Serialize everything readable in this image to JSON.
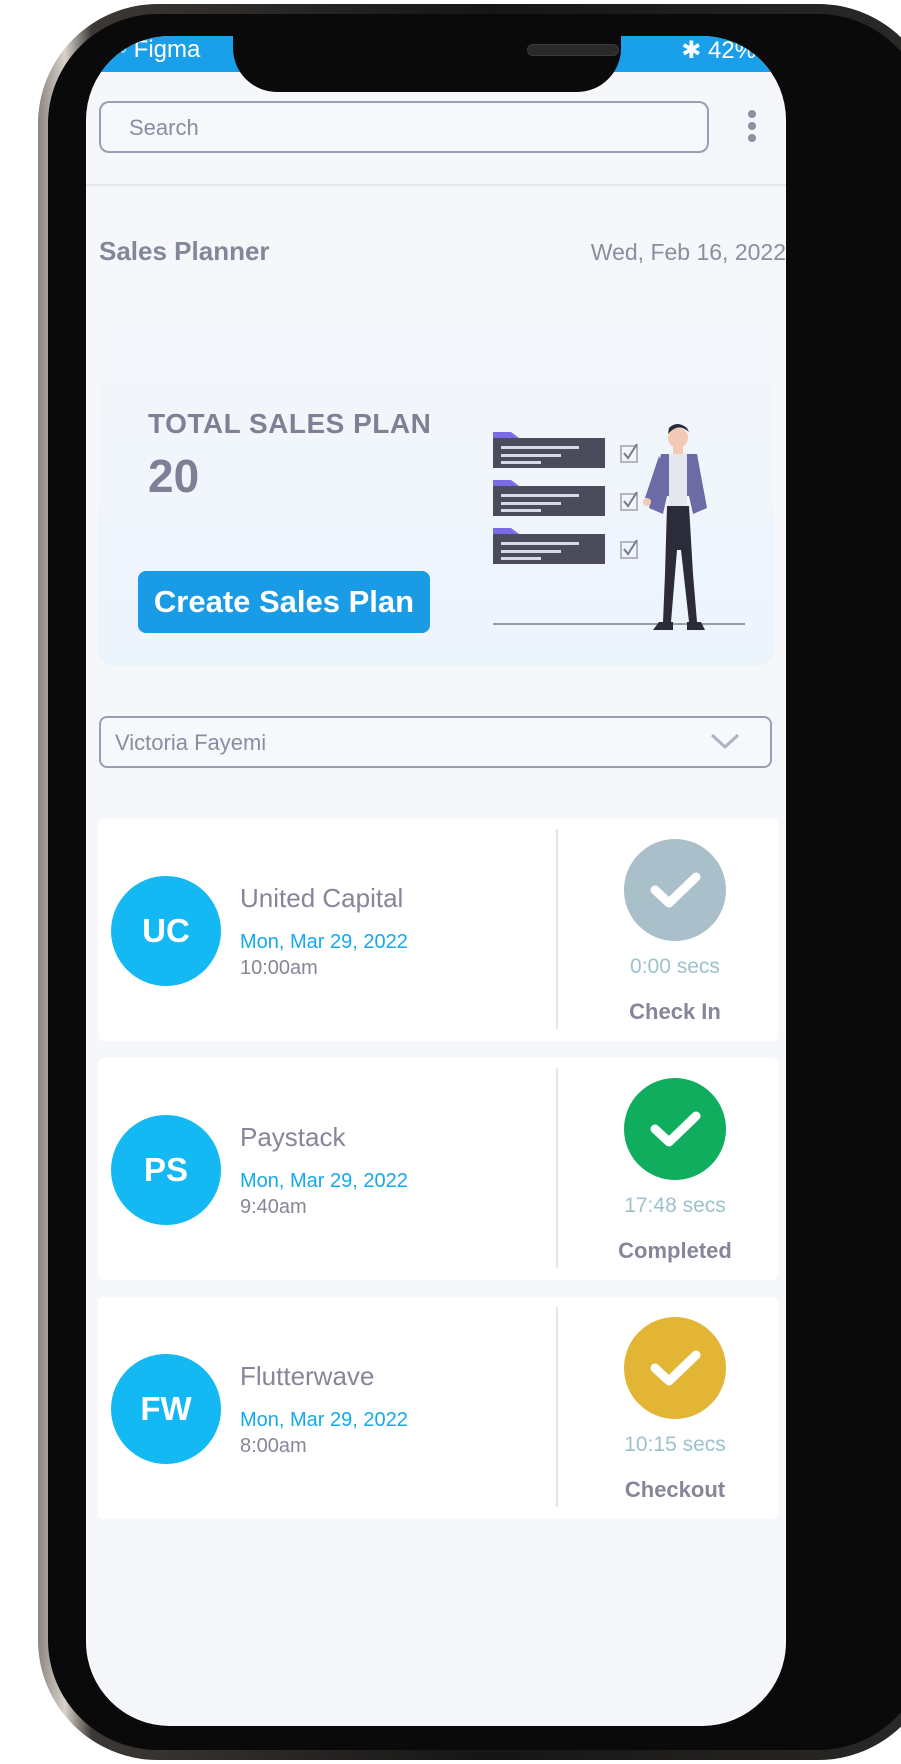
{
  "status_bar": {
    "carrier": "◦◦ Figma",
    "battery": "✱ 42%"
  },
  "search": {
    "placeholder": "Search"
  },
  "header": {
    "title": "Sales Planner",
    "date": "Wed, Feb 16, 2022"
  },
  "summary": {
    "label": "TOTAL SALES PLAN",
    "value": "20",
    "button_label": "Create Sales Plan"
  },
  "filter": {
    "selected": "Victoria Fayemi"
  },
  "visits": [
    {
      "initials": "UC",
      "company": "United Capital",
      "date": "Mon, Mar 29, 2022",
      "time": "10:00am",
      "duration": "0:00 secs",
      "status": "Check In",
      "color": "#a9bfc9"
    },
    {
      "initials": "PS",
      "company": "Paystack",
      "date": "Mon, Mar 29, 2022",
      "time": "9:40am",
      "duration": "17:48 secs",
      "status": "Completed",
      "color": "#11ad5f"
    },
    {
      "initials": "FW",
      "company": "Flutterwave",
      "date": "Mon, Mar 29, 2022",
      "time": "8:00am",
      "duration": "10:15 secs",
      "status": "Checkout",
      "color": "#e3b534"
    }
  ],
  "colors": {
    "accent": "#1a9be6",
    "avatar": "#14b9f4"
  }
}
